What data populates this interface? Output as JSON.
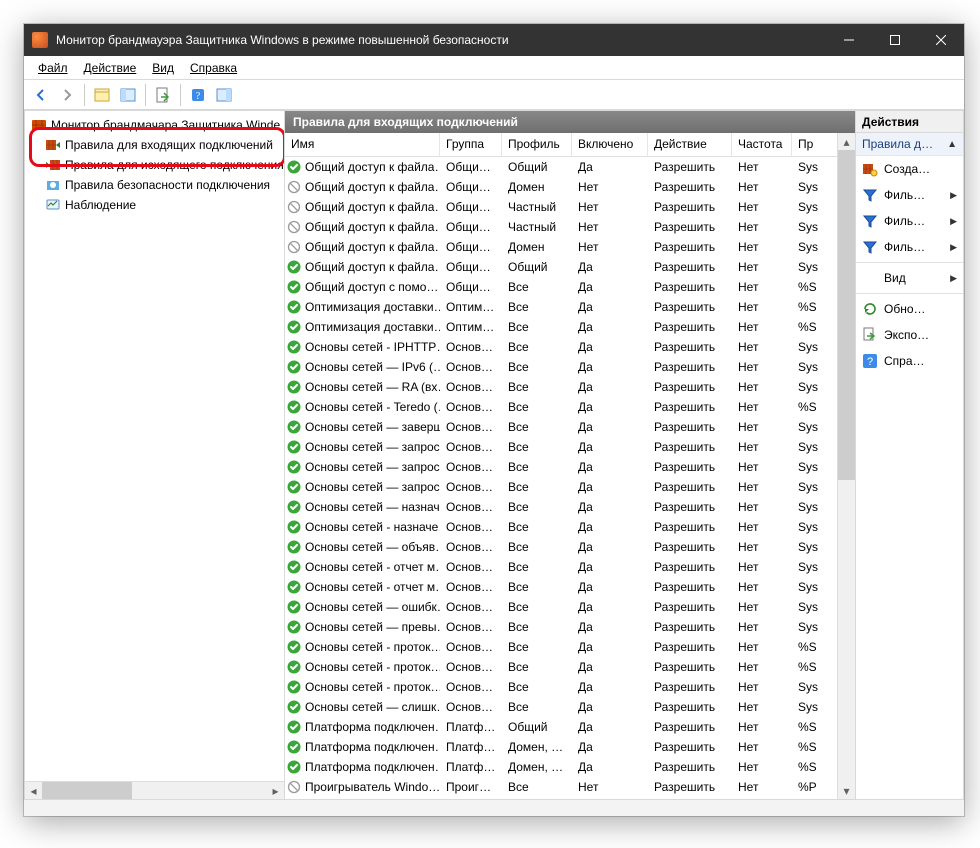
{
  "window": {
    "title": "Монитор брандмауэра Защитника Windows в режиме повышенной безопасности"
  },
  "menu": {
    "file": "Файл",
    "action": "Действие",
    "view": "Вид",
    "help": "Справка"
  },
  "tree": {
    "root": "Монитор брандмауэра Защитника Winde",
    "items": [
      "Правила для входящих подключений",
      "Правила для исходящего подключения",
      "Правила безопасности подключения",
      "Наблюдение"
    ]
  },
  "center": {
    "title": "Правила для входящих подключений",
    "columns": {
      "name": "Имя",
      "group": "Группа",
      "profile": "Профиль",
      "enabled": "Включено",
      "action": "Действие",
      "freq": "Частота",
      "prog": "Пр"
    },
    "rules": [
      {
        "on": true,
        "name": "Общий доступ к файла…",
        "group": "Общий …",
        "profile": "Общий",
        "enabled": "Да",
        "action": "Разрешить",
        "freq": "Нет",
        "prog": "Sys"
      },
      {
        "on": false,
        "name": "Общий доступ к файла…",
        "group": "Общий …",
        "profile": "Домен",
        "enabled": "Нет",
        "action": "Разрешить",
        "freq": "Нет",
        "prog": "Sys"
      },
      {
        "on": false,
        "name": "Общий доступ к файла…",
        "group": "Общий …",
        "profile": "Частный",
        "enabled": "Нет",
        "action": "Разрешить",
        "freq": "Нет",
        "prog": "Sys"
      },
      {
        "on": false,
        "name": "Общий доступ к файла…",
        "group": "Общий …",
        "profile": "Частный",
        "enabled": "Нет",
        "action": "Разрешить",
        "freq": "Нет",
        "prog": "Sys"
      },
      {
        "on": false,
        "name": "Общий доступ к файла…",
        "group": "Общий …",
        "profile": "Домен",
        "enabled": "Нет",
        "action": "Разрешить",
        "freq": "Нет",
        "prog": "Sys"
      },
      {
        "on": true,
        "name": "Общий доступ к файла…",
        "group": "Общий …",
        "profile": "Общий",
        "enabled": "Да",
        "action": "Разрешить",
        "freq": "Нет",
        "prog": "Sys"
      },
      {
        "on": true,
        "name": "Общий доступ с помо…",
        "group": "Общий …",
        "profile": "Все",
        "enabled": "Да",
        "action": "Разрешить",
        "freq": "Нет",
        "prog": "%S"
      },
      {
        "on": true,
        "name": "Оптимизация доставки…",
        "group": "Оптими…",
        "profile": "Все",
        "enabled": "Да",
        "action": "Разрешить",
        "freq": "Нет",
        "prog": "%S"
      },
      {
        "on": true,
        "name": "Оптимизация доставки…",
        "group": "Оптими…",
        "profile": "Все",
        "enabled": "Да",
        "action": "Разрешить",
        "freq": "Нет",
        "prog": "%S"
      },
      {
        "on": true,
        "name": "Основы сетей - IPHTTP…",
        "group": "Основы…",
        "profile": "Все",
        "enabled": "Да",
        "action": "Разрешить",
        "freq": "Нет",
        "prog": "Sys"
      },
      {
        "on": true,
        "name": "Основы сетей — IPv6 (…",
        "group": "Основы…",
        "profile": "Все",
        "enabled": "Да",
        "action": "Разрешить",
        "freq": "Нет",
        "prog": "Sys"
      },
      {
        "on": true,
        "name": "Основы сетей — RA (вх…",
        "group": "Основы…",
        "profile": "Все",
        "enabled": "Да",
        "action": "Разрешить",
        "freq": "Нет",
        "prog": "Sys"
      },
      {
        "on": true,
        "name": "Основы сетей - Teredo (…",
        "group": "Основы…",
        "profile": "Все",
        "enabled": "Да",
        "action": "Разрешить",
        "freq": "Нет",
        "prog": "%S"
      },
      {
        "on": true,
        "name": "Основы сетей — заверш…",
        "group": "Основы…",
        "profile": "Все",
        "enabled": "Да",
        "action": "Разрешить",
        "freq": "Нет",
        "prog": "Sys"
      },
      {
        "on": true,
        "name": "Основы сетей — запрос…",
        "group": "Основы…",
        "profile": "Все",
        "enabled": "Да",
        "action": "Разрешить",
        "freq": "Нет",
        "prog": "Sys"
      },
      {
        "on": true,
        "name": "Основы сетей — запрос…",
        "group": "Основы…",
        "profile": "Все",
        "enabled": "Да",
        "action": "Разрешить",
        "freq": "Нет",
        "prog": "Sys"
      },
      {
        "on": true,
        "name": "Основы сетей — запрос…",
        "group": "Основы…",
        "profile": "Все",
        "enabled": "Да",
        "action": "Разрешить",
        "freq": "Нет",
        "prog": "Sys"
      },
      {
        "on": true,
        "name": "Основы сетей — назнач…",
        "group": "Основы…",
        "profile": "Все",
        "enabled": "Да",
        "action": "Разрешить",
        "freq": "Нет",
        "prog": "Sys"
      },
      {
        "on": true,
        "name": "Основы сетей - назначе…",
        "group": "Основы…",
        "profile": "Все",
        "enabled": "Да",
        "action": "Разрешить",
        "freq": "Нет",
        "prog": "Sys"
      },
      {
        "on": true,
        "name": "Основы сетей — объяв…",
        "group": "Основы…",
        "profile": "Все",
        "enabled": "Да",
        "action": "Разрешить",
        "freq": "Нет",
        "prog": "Sys"
      },
      {
        "on": true,
        "name": "Основы сетей - отчет м…",
        "group": "Основы…",
        "profile": "Все",
        "enabled": "Да",
        "action": "Разрешить",
        "freq": "Нет",
        "prog": "Sys"
      },
      {
        "on": true,
        "name": "Основы сетей - отчет м…",
        "group": "Основы…",
        "profile": "Все",
        "enabled": "Да",
        "action": "Разрешить",
        "freq": "Нет",
        "prog": "Sys"
      },
      {
        "on": true,
        "name": "Основы сетей — ошибк…",
        "group": "Основы…",
        "profile": "Все",
        "enabled": "Да",
        "action": "Разрешить",
        "freq": "Нет",
        "prog": "Sys"
      },
      {
        "on": true,
        "name": "Основы сетей — превы…",
        "group": "Основы…",
        "profile": "Все",
        "enabled": "Да",
        "action": "Разрешить",
        "freq": "Нет",
        "prog": "Sys"
      },
      {
        "on": true,
        "name": "Основы сетей - проток…",
        "group": "Основы…",
        "profile": "Все",
        "enabled": "Да",
        "action": "Разрешить",
        "freq": "Нет",
        "prog": "%S"
      },
      {
        "on": true,
        "name": "Основы сетей - проток…",
        "group": "Основы…",
        "profile": "Все",
        "enabled": "Да",
        "action": "Разрешить",
        "freq": "Нет",
        "prog": "%S"
      },
      {
        "on": true,
        "name": "Основы сетей - проток…",
        "group": "Основы…",
        "profile": "Все",
        "enabled": "Да",
        "action": "Разрешить",
        "freq": "Нет",
        "prog": "Sys"
      },
      {
        "on": true,
        "name": "Основы сетей — слишк…",
        "group": "Основы…",
        "profile": "Все",
        "enabled": "Да",
        "action": "Разрешить",
        "freq": "Нет",
        "prog": "Sys"
      },
      {
        "on": true,
        "name": "Платформа подключен…",
        "group": "Платфо…",
        "profile": "Общий",
        "enabled": "Да",
        "action": "Разрешить",
        "freq": "Нет",
        "prog": "%S"
      },
      {
        "on": true,
        "name": "Платформа подключен…",
        "group": "Платфо…",
        "profile": "Домен, Ч…",
        "enabled": "Да",
        "action": "Разрешить",
        "freq": "Нет",
        "prog": "%S"
      },
      {
        "on": true,
        "name": "Платформа подключен…",
        "group": "Платфо…",
        "profile": "Домен, Ч…",
        "enabled": "Да",
        "action": "Разрешить",
        "freq": "Нет",
        "prog": "%S"
      },
      {
        "on": false,
        "name": "Проигрыватель Windo…",
        "group": "Проигр…",
        "profile": "Все",
        "enabled": "Нет",
        "action": "Разрешить",
        "freq": "Нет",
        "prog": "%P"
      }
    ]
  },
  "actions": {
    "header": "Действия",
    "sub": "Правила д…",
    "items": [
      {
        "label": "Созда…",
        "icon": "new-rule"
      },
      {
        "label": "Филь…",
        "icon": "filter",
        "submenu": true
      },
      {
        "label": "Филь…",
        "icon": "filter",
        "submenu": true
      },
      {
        "label": "Филь…",
        "icon": "filter",
        "submenu": true
      },
      {
        "label": "Вид",
        "icon": "none",
        "submenu": true
      },
      {
        "label": "Обно…",
        "icon": "refresh"
      },
      {
        "label": "Экспо…",
        "icon": "export"
      },
      {
        "label": "Спра…",
        "icon": "help"
      }
    ]
  }
}
